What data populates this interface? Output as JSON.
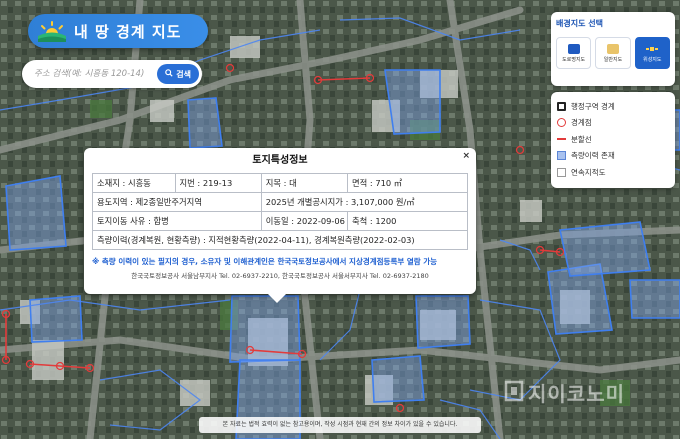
{
  "app": {
    "title": "내 땅 경계 지도"
  },
  "search": {
    "placeholder": "주소 검색(예: 시흥동 120-14)",
    "button_label": "검색"
  },
  "basemap": {
    "title": "배경지도 선택",
    "options": [
      {
        "label": "도로명지도",
        "icon": "road-map-icon",
        "active": false
      },
      {
        "label": "일반지도",
        "icon": "general-map-icon",
        "active": false
      },
      {
        "label": "위성지도",
        "icon": "satellite-icon",
        "active": true
      }
    ]
  },
  "legend": {
    "items": [
      {
        "label": "행정구역 경계",
        "icon": "boundary-icon"
      },
      {
        "label": "경계점",
        "icon": "boundary-point-icon"
      },
      {
        "label": "분할선",
        "icon": "division-line-icon"
      },
      {
        "label": "측량이력 존재",
        "icon": "survey-history-icon"
      },
      {
        "label": "연속지적도",
        "icon": "cadastral-map-icon"
      }
    ]
  },
  "popup": {
    "title": "토지특성정보",
    "close": "×",
    "rows": {
      "address": "소재지 : 시흥동",
      "lot": "지번 : 219-13",
      "category": "지목 : 대",
      "area": "면적 : 710 ㎡",
      "zoning": "용도지역 : 제2종일반주거지역",
      "price": "2025년 개별공시지가 : 3,107,000 원/㎡",
      "move_reason": "토지이동 사유 : 합병",
      "move_date": "이동일 : 2022-09-06",
      "scale": "축척 : 1200",
      "survey": "측량이력(경계복원, 현황측량) : 지적현황측량(2022-04-11), 경계복원측량(2022-02-03)"
    },
    "notice": "※ 측량 이력이 있는 필지의 경우, 소유자 및 이해관계인은 한국국토정보공사에서 지상경계점등록부 열람 가능",
    "contact": "한국국토정보공사 서울남부지사 Tel. 02-6937-2210, 한국국토정보공사 서울서부지사 Tel. 02-6937-2180"
  },
  "footer": {
    "disclaimer": "본 자료는 법적 효력이 없는 참고용이며, 작성 시점과 현재 간의 정보 차이가 있을 수 있습니다."
  },
  "watermark": {
    "text": "지이코노미"
  },
  "colors": {
    "accent": "#2a6fd6",
    "boundary_blue": "#3f7ff0",
    "boundary_point": "#e23b3b",
    "survey_fill": "#a9c2ef"
  }
}
